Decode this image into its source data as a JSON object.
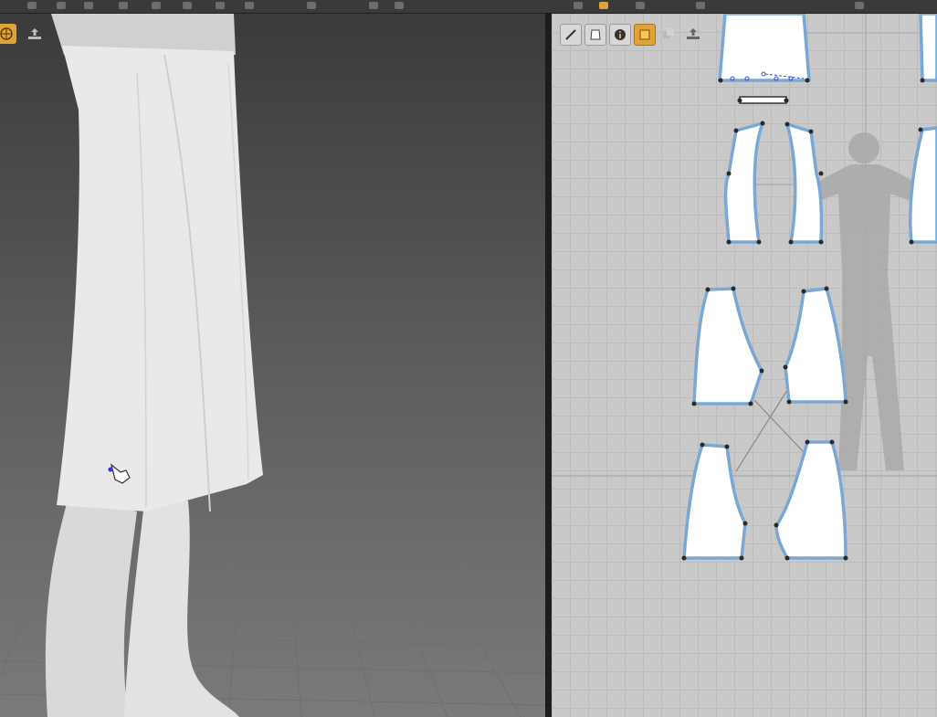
{
  "app": {
    "accent_color": "#e0a33a",
    "pattern_outline_color": "#7aa7d4",
    "icons": {
      "top_toolbar": [
        "cursor-icon",
        "move-icon",
        "rotate-icon",
        "scale-icon",
        "select-icon",
        "transform-icon",
        "sew-icon",
        "fold-icon",
        "pin-icon",
        "measure-icon",
        "undo-icon",
        "redo-icon",
        "zoom-icon",
        "fit-icon",
        "avatar-icon",
        "sim-icon"
      ],
      "view3d_toolbar": [
        "globe-display-icon",
        "export-icon"
      ],
      "view2d_toolbar": [
        "line-pen-icon",
        "garment-display-icon",
        "info-icon",
        "texture-icon",
        "layout-icon",
        "export-icon"
      ]
    }
  }
}
